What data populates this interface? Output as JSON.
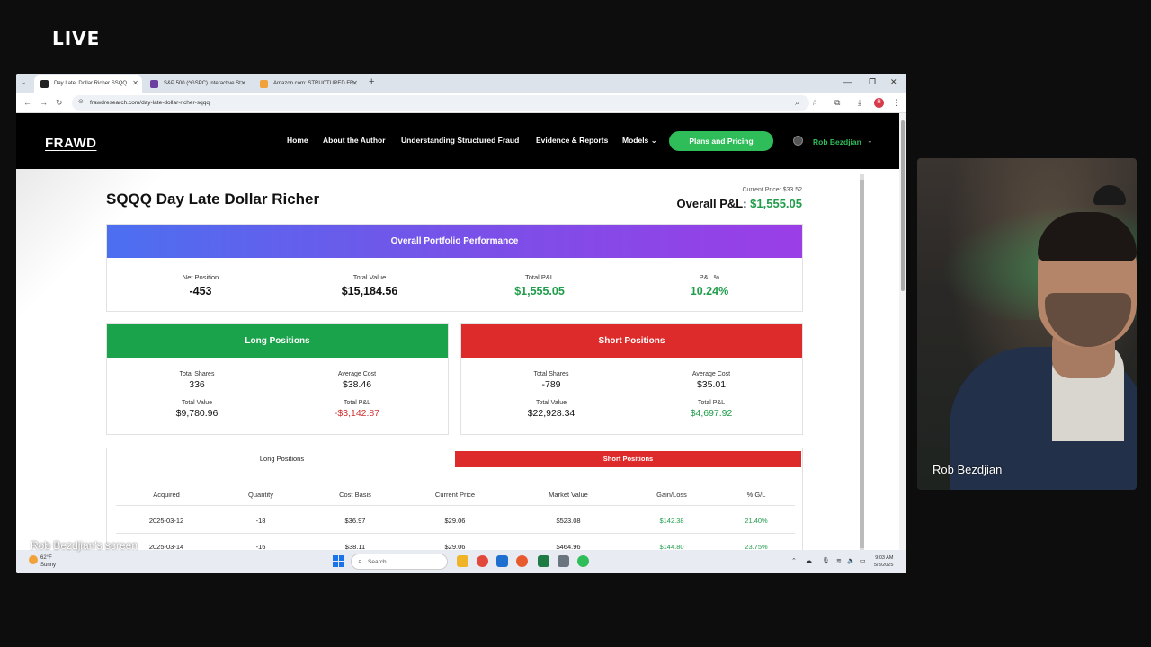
{
  "overlay": {
    "live_label": "LIVE",
    "webcam_name": "Rob Bezdjian",
    "screen_overlay_name": "Rob Bezdjian's screen"
  },
  "browser": {
    "tabs": [
      {
        "title": "Day Late, Dollar Richer SSQQ",
        "active": true,
        "favicon_color": "#222222"
      },
      {
        "title": "S&P 500 (^GSPC) Interactive St",
        "active": false,
        "favicon_color": "#6b3fa0"
      },
      {
        "title": "Amazon.com: STRUCTURED FR",
        "active": false,
        "favicon_color": "#f2a23a"
      }
    ],
    "url": "frawdresearch.com/day-late-dollar-richer-sqqq",
    "profile_initial": "R"
  },
  "site": {
    "logo": "FRAWD",
    "nav": [
      "Home",
      "About the Author",
      "Understanding Structured Fraud",
      "Evidence & Reports",
      "Models"
    ],
    "plans_button": "Plans and Pricing",
    "user_name": "Rob Bezdjian",
    "accent_green": "#2ebd59"
  },
  "page": {
    "title": "SQQQ Day Late Dollar Richer",
    "current_price": "Current Price: $33.52",
    "overall_pl_label": "Overall P&L:",
    "overall_pl_value": "$1,555.05"
  },
  "portfolio": {
    "heading": "Overall Portfolio Performance",
    "stats": [
      {
        "label": "Net Position",
        "value": "-453"
      },
      {
        "label": "Total Value",
        "value": "$15,184.56"
      },
      {
        "label": "Total P&L",
        "value": "$1,555.05"
      },
      {
        "label": "P&L %",
        "value": "10.24%"
      }
    ]
  },
  "long": {
    "heading": "Long Positions",
    "total_shares_label": "Total Shares",
    "total_shares": "336",
    "avg_cost_label": "Average Cost",
    "avg_cost": "$38.46",
    "total_value_label": "Total Value",
    "total_value": "$9,780.96",
    "total_pl_label": "Total P&L",
    "total_pl": "-$3,142.87"
  },
  "short": {
    "heading": "Short Positions",
    "total_shares_label": "Total Shares",
    "total_shares": "-789",
    "avg_cost_label": "Average Cost",
    "avg_cost": "$35.01",
    "total_value_label": "Total Value",
    "total_value": "$22,928.34",
    "total_pl_label": "Total P&L",
    "total_pl": "$4,697.92"
  },
  "positions_table": {
    "tabs": [
      "Long Positions",
      "Short Positions"
    ],
    "active_tab": "Short Positions",
    "columns": [
      "Acquired",
      "Quantity",
      "Cost Basis",
      "Current Price",
      "Market Value",
      "Gain/Loss",
      "% G/L"
    ],
    "rows": [
      [
        "2025-03-12",
        "-18",
        "$36.97",
        "$29.06",
        "$523.08",
        "$142.38",
        "21.40%"
      ],
      [
        "2025-03-14",
        "-16",
        "$38.11",
        "$29.06",
        "$464.96",
        "$144.80",
        "23.75%"
      ]
    ]
  },
  "taskbar": {
    "temp": "62°F",
    "condition": "Sunny",
    "search_placeholder": "Search",
    "time": "9:03 AM",
    "date": "5/8/2025"
  }
}
